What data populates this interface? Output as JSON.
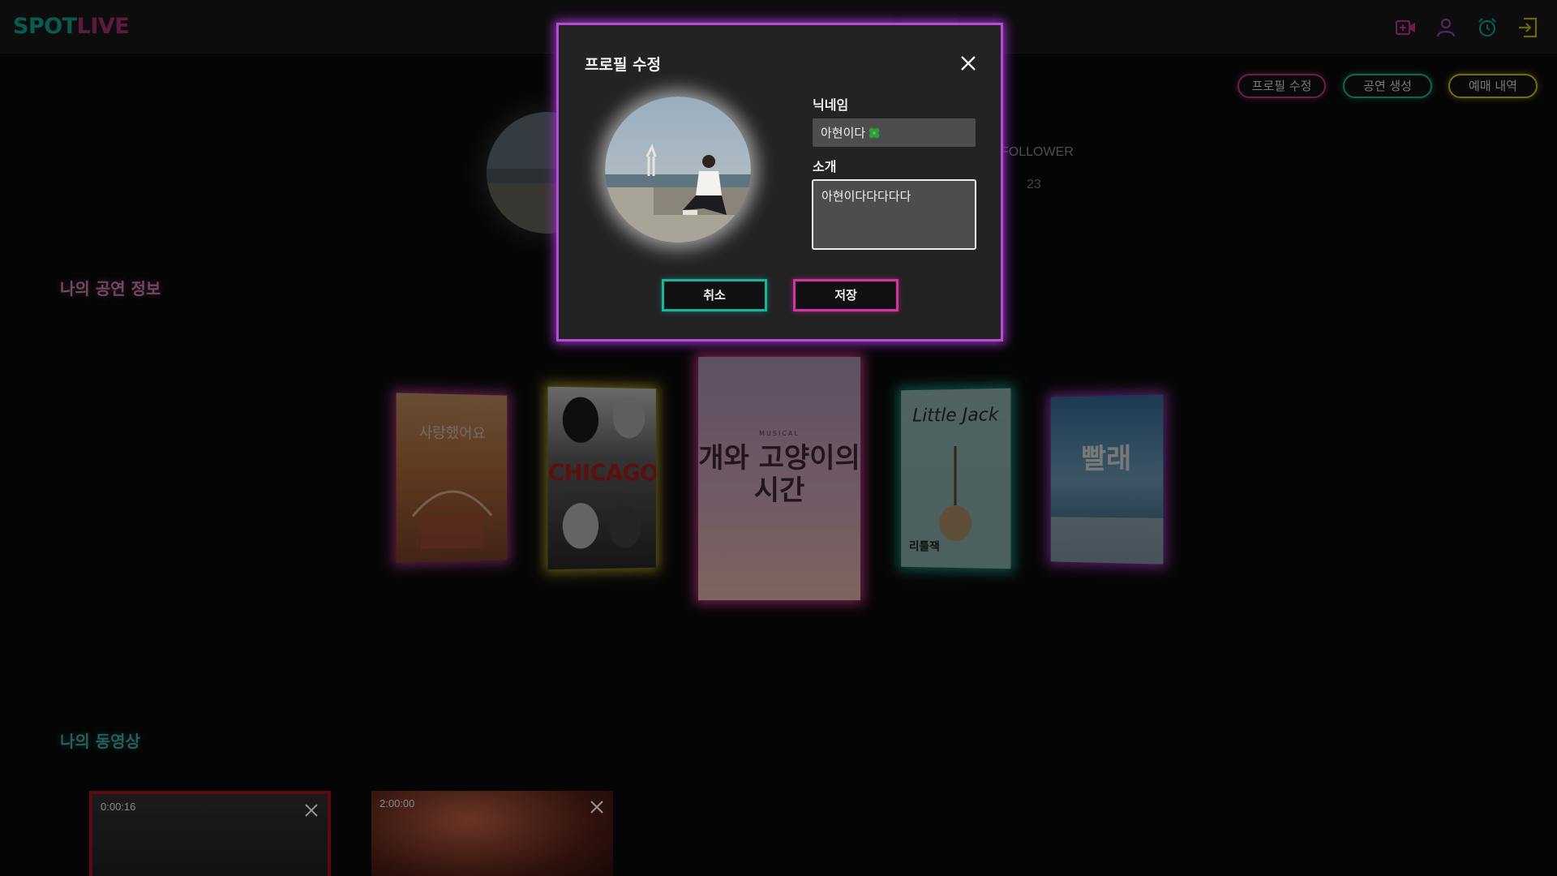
{
  "header": {
    "logo_spot": "SPOT",
    "logo_live": "LIVE",
    "icons": [
      "video-camera-icon",
      "user-icon",
      "alarm-clock-icon",
      "logout-icon"
    ],
    "colors": {
      "logo_spot": "#0e8c7a",
      "logo_live": "#8e2a5e",
      "icon_live": "#a0306f",
      "icon_user": "#7a3d96",
      "icon_alarm": "#0e8c7a",
      "icon_logout": "#a99a14"
    }
  },
  "profile": {
    "follower_label": "FOLLOWER",
    "follower_count": "23",
    "actions": {
      "edit_profile": "프로필 수정",
      "create_show": "공연 생성",
      "booking_history": "예매 내역"
    }
  },
  "sections": {
    "shows_title": "나의 공연 정보",
    "videos_title": "나의 동영상"
  },
  "posters": [
    {
      "title": "사랑했어요",
      "glow": "#c23a9b"
    },
    {
      "title": "CHICAGO",
      "glow": "#c9b52a"
    },
    {
      "tag": "MUSICAL",
      "title": "개와 고양이의 시간",
      "glow": "#cf3a8d"
    },
    {
      "title": "Little Jack",
      "subtitle": "리틀잭",
      "glow": "#1aa58c"
    },
    {
      "title": "빨래",
      "glow": "#b23dd6"
    }
  ],
  "videos": [
    {
      "duration": "0:00:16"
    },
    {
      "duration": "2:00:00"
    }
  ],
  "modal": {
    "title": "프로필 수정",
    "nickname_label": "닉네임",
    "nickname_value": "아현이다",
    "intro_label": "소개",
    "intro_value": "아현이다다다다다",
    "cancel_label": "취소",
    "save_label": "저장",
    "border_color": "#b74bd6"
  }
}
